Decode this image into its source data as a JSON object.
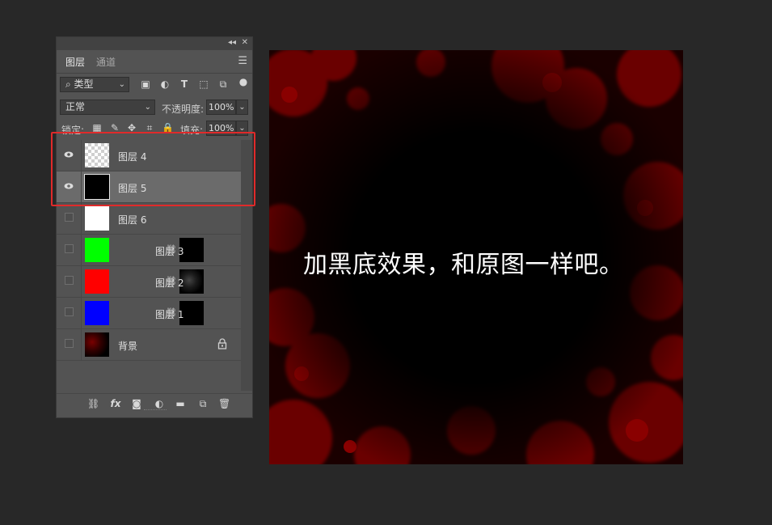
{
  "panel": {
    "tabs": [
      {
        "label": "图层"
      },
      {
        "label": "通道"
      }
    ],
    "filter": {
      "label": "类型"
    },
    "blend_mode": {
      "label": "正常"
    },
    "opacity": {
      "label": "不透明度:",
      "value": "100%"
    },
    "lock": {
      "label": "锁定:"
    },
    "fill": {
      "label": "填充:",
      "value": "100%"
    },
    "layers": [
      {
        "name": "图层 4",
        "visible": true,
        "selected": false,
        "thumb": "transparent"
      },
      {
        "name": "图层 5",
        "visible": true,
        "selected": true,
        "thumb": "black"
      },
      {
        "name": "图层 6",
        "visible": false,
        "selected": false,
        "thumb": "white"
      },
      {
        "name": "图层 3",
        "visible": false,
        "selected": false,
        "thumb": "#00ff00",
        "mask": "black"
      },
      {
        "name": "图层 2",
        "visible": false,
        "selected": false,
        "thumb": "#ff0000",
        "mask": "splatter"
      },
      {
        "name": "图层 1",
        "visible": false,
        "selected": false,
        "thumb": "#0000ff",
        "mask": "black"
      },
      {
        "name": "背景",
        "visible": false,
        "selected": false,
        "thumb": "splatter",
        "locked": true
      }
    ],
    "bottom_icons": [
      "link-icon",
      "fx-icon",
      "add-mask-icon",
      "adjustment-icon",
      "folder-icon",
      "new-layer-icon",
      "trash-icon"
    ]
  },
  "canvas": {
    "caption": "加黑底效果，和原图一样吧。"
  },
  "colors": {
    "panel_bg": "#535353",
    "selected_row": "#6b6b6b",
    "highlight_border": "#e02a2a",
    "splatter_red": "#6a0000"
  }
}
